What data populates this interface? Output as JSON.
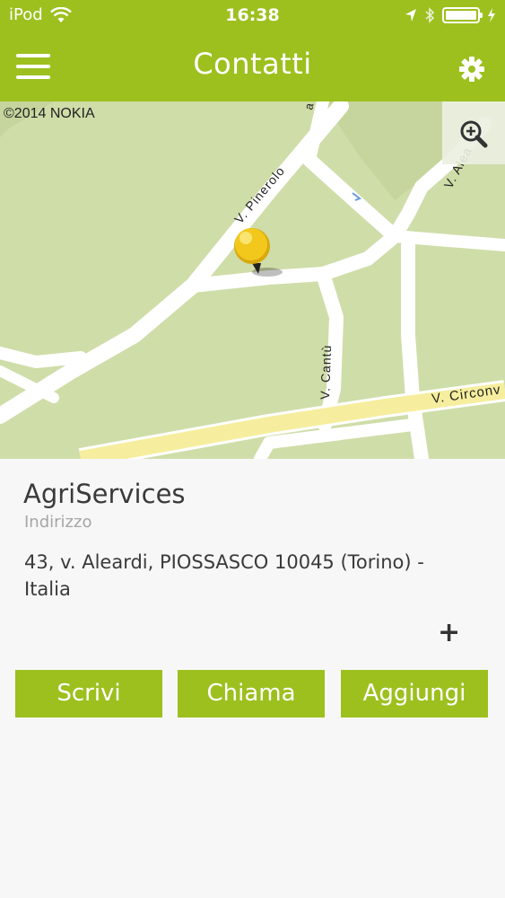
{
  "status_bar": {
    "carrier": "iPod",
    "time": "16:38"
  },
  "nav": {
    "title": "Contatti",
    "menu_icon": "hamburger-menu-icon",
    "settings_icon": "gear-icon"
  },
  "map": {
    "credit": "©2014 NOKIA",
    "street_labels": [
      "V. Pinerolo",
      "V. Cantù",
      "V. Circonv",
      "V. Alea"
    ],
    "zoom_icon": "zoom-in-icon"
  },
  "contact": {
    "company": "AgriServices",
    "address_label": "Indirizzo",
    "address": "43, v. Aleardi, PIOSSASCO 10045 (Torino) - Italia",
    "expand_label": "+"
  },
  "actions": {
    "write_label": "Scrivi",
    "call_label": "Chiama",
    "add_label": "Aggiungi"
  },
  "colors": {
    "accent": "#9dc01f",
    "map_green": "#cfdda9",
    "road_yellow": "#f6ee9e",
    "pin_yellow": "#f2c81d"
  }
}
